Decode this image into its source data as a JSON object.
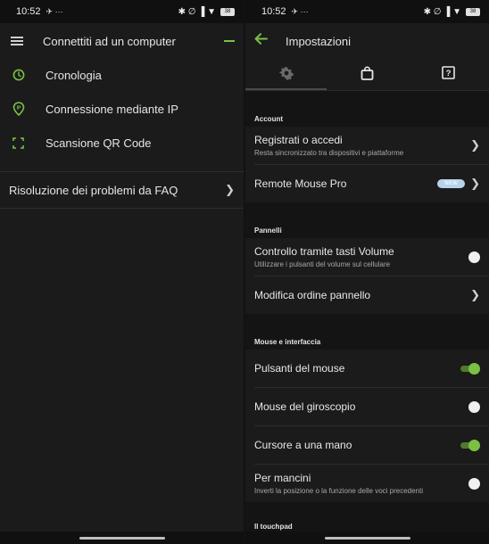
{
  "left": {
    "status": {
      "time": "10:52",
      "extra": "✈ ···",
      "icons": "✱ ∅ ▐ ▼",
      "battery": "38"
    },
    "header": {
      "title": "Connettiti ad un computer"
    },
    "menu": [
      {
        "label": "Cronologia",
        "icon": "clock-icon"
      },
      {
        "label": "Connessione mediante IP",
        "icon": "ip-pin-icon"
      },
      {
        "label": "Scansione QR Code",
        "icon": "qr-scan-icon"
      }
    ],
    "faq": {
      "label": "Risoluzione dei problemi da FAQ",
      "chevron": "❯"
    }
  },
  "right": {
    "status": {
      "time": "10:52",
      "extra": "✈ ···",
      "icons": "✱ ∅ ▐ ▼",
      "battery": "38"
    },
    "header": {
      "title": "Impostazioni"
    },
    "tabs": [
      {
        "icon": "gear-icon",
        "active": true
      },
      {
        "icon": "shopping-bag-icon",
        "active": false
      },
      {
        "icon": "help-box-icon",
        "active": false
      }
    ],
    "sections": {
      "account": "Account",
      "pannelli": "Pannelli",
      "mouse": "Mouse e interfaccia",
      "touchpad": "Il touchpad"
    },
    "rows": {
      "register": {
        "main": "Registrati o accedi",
        "sub": "Resta sincronizzato tra dispositivi e piattaforme",
        "chevron": "❯"
      },
      "pro": {
        "main": "Remote Mouse Pro",
        "badge": "NEW",
        "chevron": "❯"
      },
      "volume": {
        "main": "Controllo tramite tasti Volume",
        "sub": "Utilizzare i pulsanti del volume sul cellulare",
        "on": false
      },
      "order": {
        "main": "Modifica ordine pannello",
        "chevron": "❯"
      },
      "buttons": {
        "main": "Pulsanti del mouse",
        "on": true
      },
      "gyro": {
        "main": "Mouse del giroscopio",
        "on": false
      },
      "onehand": {
        "main": "Cursore a una mano",
        "on": true
      },
      "lefty": {
        "main": "Per mancini",
        "sub": "Inverti la posizione o la funzione delle voci precedenti",
        "on": false
      }
    }
  },
  "colors": {
    "accent": "#7ac143",
    "background": "#1b1b1b",
    "section_bg": "#141414",
    "badge": "#b7d3ea"
  }
}
